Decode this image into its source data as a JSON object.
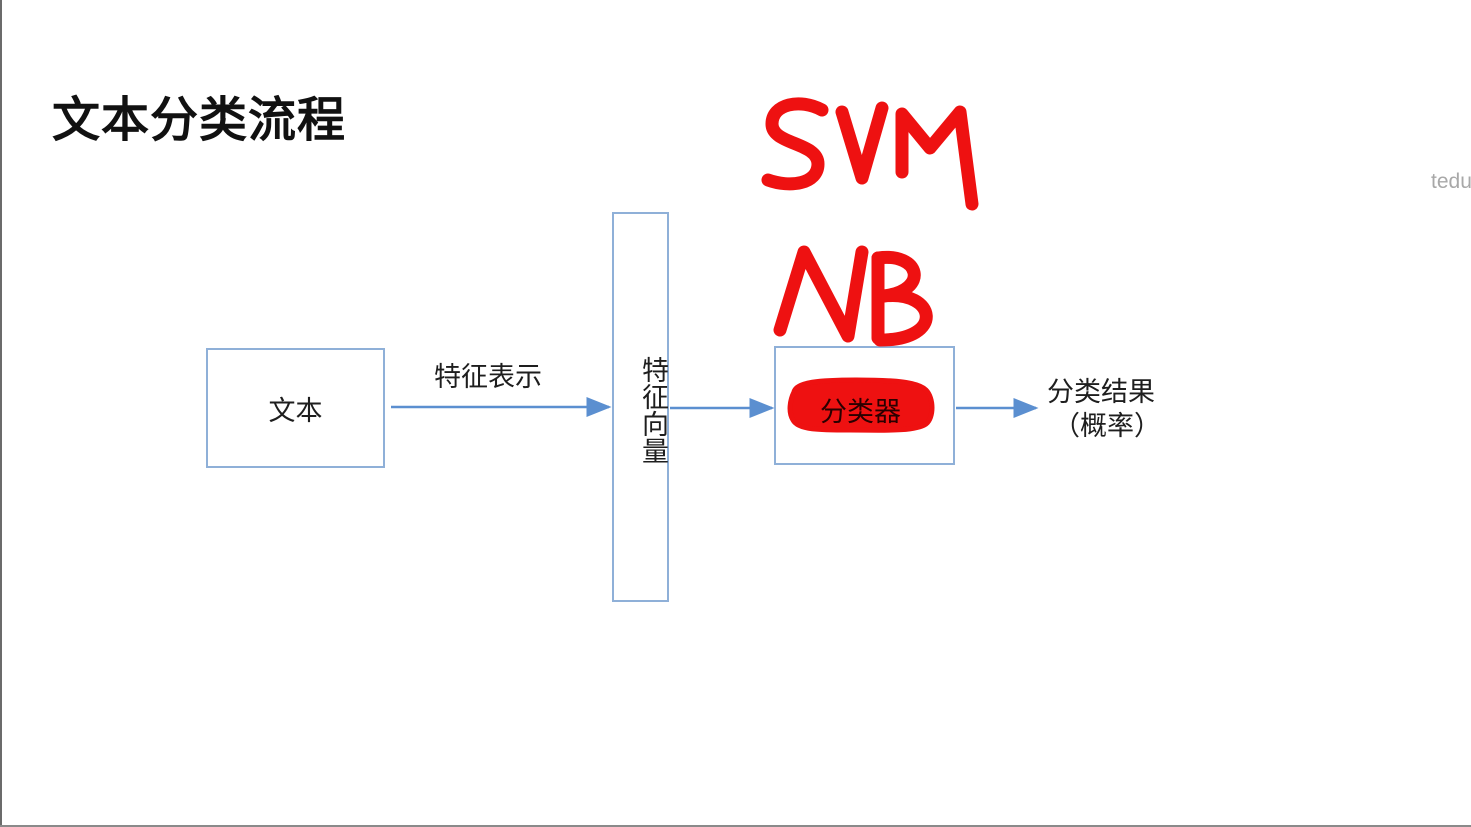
{
  "slide": {
    "title": "文本分类流程",
    "watermark": "tedu"
  },
  "diagram": {
    "nodes": {
      "text": "文本",
      "feature_vector": "特征向量",
      "classifier": "分类器"
    },
    "edges": {
      "text_to_vector": "特征表示",
      "vector_to_classifier": "",
      "classifier_to_result": ""
    },
    "output": {
      "line1": "分类结果",
      "line2": "（概率）"
    }
  },
  "annotations": {
    "handwritten": [
      "SVM",
      "NB"
    ],
    "ink_color": "#ee1111",
    "box_color": "#8fb0d8",
    "arrow_color": "#5b8fd0"
  }
}
